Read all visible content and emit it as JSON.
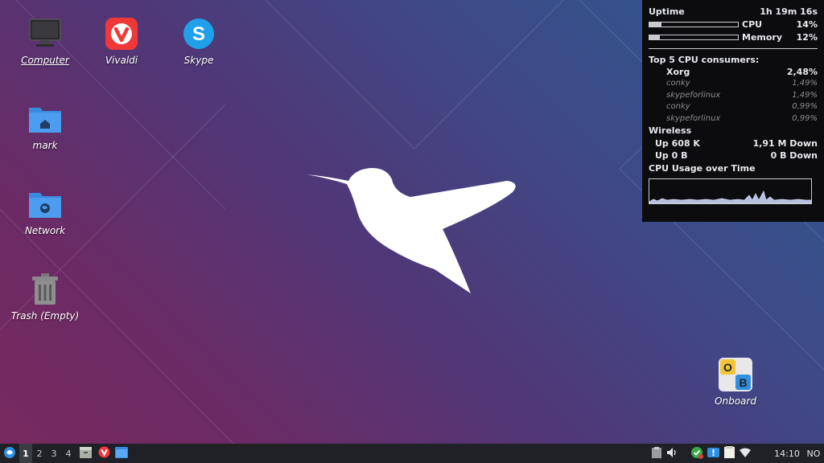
{
  "desktop": {
    "icons": [
      {
        "label": "Computer",
        "icon": "computer-icon"
      },
      {
        "label": "Vivaldi",
        "icon": "vivaldi-icon"
      },
      {
        "label": "Skype",
        "icon": "skype-icon"
      },
      {
        "label": "mark",
        "icon": "home-folder-icon"
      },
      {
        "label": "Network",
        "icon": "network-folder-icon"
      },
      {
        "label": "Trash (Empty)",
        "icon": "trash-icon"
      },
      {
        "label": "Onboard",
        "icon": "onboard-icon"
      }
    ],
    "wallpaper_colors": {
      "top_right": "#2d5a8f",
      "bottom_left": "#782a5e"
    }
  },
  "conky": {
    "uptime_label": "Uptime",
    "uptime_value": "1h 19m 16s",
    "cpu_label": "CPU",
    "cpu_value": "14%",
    "cpu_fraction": 0.14,
    "memory_label": "Memory",
    "memory_value": "12%",
    "memory_fraction": 0.12,
    "top_title": "Top 5 CPU consumers:",
    "processes": [
      {
        "name": "Xorg",
        "value": "2,48%"
      },
      {
        "name": "conky",
        "value": "1,49%"
      },
      {
        "name": "skypeforlinux",
        "value": "1,49%"
      },
      {
        "name": "conky",
        "value": "0,99%"
      },
      {
        "name": "skypeforlinux",
        "value": "0,99%"
      }
    ],
    "wireless_label": "Wireless",
    "net": [
      {
        "up": "Up 608 K",
        "down": "1,91 M Down"
      },
      {
        "up": "Up 0 B",
        "down": "0 B Down"
      }
    ],
    "graph_label": "CPU Usage over Time"
  },
  "taskbar": {
    "workspaces": [
      "1",
      "2",
      "3",
      "4"
    ],
    "active_workspace": "1",
    "clock": "14:10",
    "keyboard_layout": "NO"
  }
}
